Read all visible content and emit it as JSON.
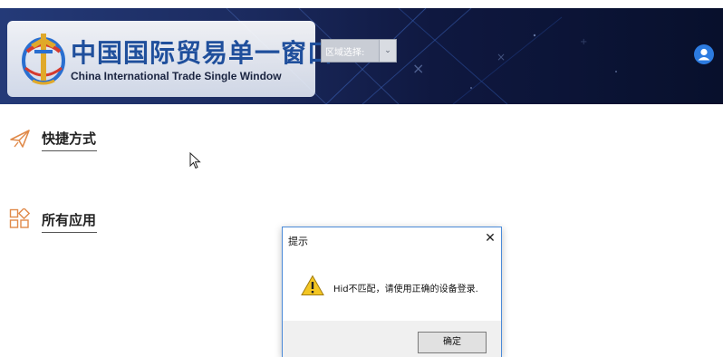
{
  "header": {
    "title_cn": "中国国际贸易单一窗口",
    "title_en": "China International Trade Single  Window",
    "region_select": {
      "label": "区域选择:",
      "arrow": "⌄"
    },
    "user_icon": "user-icon"
  },
  "sections": {
    "shortcuts": {
      "title": "快捷方式",
      "icon": "paper-plane-icon",
      "icon_color": "#e08a4a"
    },
    "all_apps": {
      "title": "所有应用",
      "icon": "apps-grid-icon",
      "icon_color": "#e08a4a"
    }
  },
  "dialog": {
    "title": "提示",
    "close": "✕",
    "icon": "warning-icon",
    "message": "Hid不匹配，请使用正确的设备登录.",
    "ok_label": "确定"
  },
  "colors": {
    "header_bg": "#1b2a5e",
    "brand_blue": "#1f4f9c",
    "accent_orange": "#e08a4a",
    "dialog_border": "#4a8ad8"
  }
}
